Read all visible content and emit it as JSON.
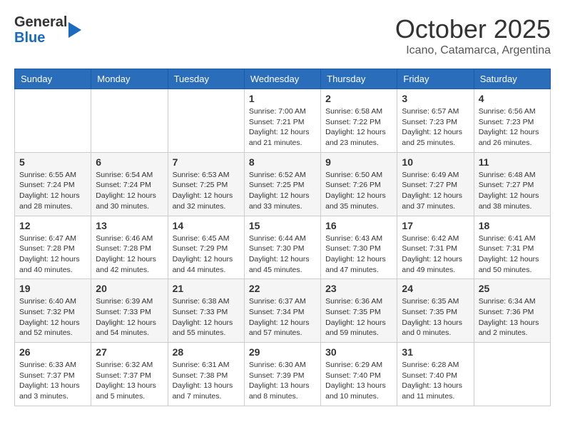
{
  "header": {
    "logo_general": "General",
    "logo_blue": "Blue",
    "month": "October 2025",
    "location": "Icano, Catamarca, Argentina"
  },
  "days_of_week": [
    "Sunday",
    "Monday",
    "Tuesday",
    "Wednesday",
    "Thursday",
    "Friday",
    "Saturday"
  ],
  "weeks": [
    [
      {
        "day": "",
        "info": ""
      },
      {
        "day": "",
        "info": ""
      },
      {
        "day": "",
        "info": ""
      },
      {
        "day": "1",
        "info": "Sunrise: 7:00 AM\nSunset: 7:21 PM\nDaylight: 12 hours\nand 21 minutes."
      },
      {
        "day": "2",
        "info": "Sunrise: 6:58 AM\nSunset: 7:22 PM\nDaylight: 12 hours\nand 23 minutes."
      },
      {
        "day": "3",
        "info": "Sunrise: 6:57 AM\nSunset: 7:23 PM\nDaylight: 12 hours\nand 25 minutes."
      },
      {
        "day": "4",
        "info": "Sunrise: 6:56 AM\nSunset: 7:23 PM\nDaylight: 12 hours\nand 26 minutes."
      }
    ],
    [
      {
        "day": "5",
        "info": "Sunrise: 6:55 AM\nSunset: 7:24 PM\nDaylight: 12 hours\nand 28 minutes."
      },
      {
        "day": "6",
        "info": "Sunrise: 6:54 AM\nSunset: 7:24 PM\nDaylight: 12 hours\nand 30 minutes."
      },
      {
        "day": "7",
        "info": "Sunrise: 6:53 AM\nSunset: 7:25 PM\nDaylight: 12 hours\nand 32 minutes."
      },
      {
        "day": "8",
        "info": "Sunrise: 6:52 AM\nSunset: 7:25 PM\nDaylight: 12 hours\nand 33 minutes."
      },
      {
        "day": "9",
        "info": "Sunrise: 6:50 AM\nSunset: 7:26 PM\nDaylight: 12 hours\nand 35 minutes."
      },
      {
        "day": "10",
        "info": "Sunrise: 6:49 AM\nSunset: 7:27 PM\nDaylight: 12 hours\nand 37 minutes."
      },
      {
        "day": "11",
        "info": "Sunrise: 6:48 AM\nSunset: 7:27 PM\nDaylight: 12 hours\nand 38 minutes."
      }
    ],
    [
      {
        "day": "12",
        "info": "Sunrise: 6:47 AM\nSunset: 7:28 PM\nDaylight: 12 hours\nand 40 minutes."
      },
      {
        "day": "13",
        "info": "Sunrise: 6:46 AM\nSunset: 7:28 PM\nDaylight: 12 hours\nand 42 minutes."
      },
      {
        "day": "14",
        "info": "Sunrise: 6:45 AM\nSunset: 7:29 PM\nDaylight: 12 hours\nand 44 minutes."
      },
      {
        "day": "15",
        "info": "Sunrise: 6:44 AM\nSunset: 7:30 PM\nDaylight: 12 hours\nand 45 minutes."
      },
      {
        "day": "16",
        "info": "Sunrise: 6:43 AM\nSunset: 7:30 PM\nDaylight: 12 hours\nand 47 minutes."
      },
      {
        "day": "17",
        "info": "Sunrise: 6:42 AM\nSunset: 7:31 PM\nDaylight: 12 hours\nand 49 minutes."
      },
      {
        "day": "18",
        "info": "Sunrise: 6:41 AM\nSunset: 7:31 PM\nDaylight: 12 hours\nand 50 minutes."
      }
    ],
    [
      {
        "day": "19",
        "info": "Sunrise: 6:40 AM\nSunset: 7:32 PM\nDaylight: 12 hours\nand 52 minutes."
      },
      {
        "day": "20",
        "info": "Sunrise: 6:39 AM\nSunset: 7:33 PM\nDaylight: 12 hours\nand 54 minutes."
      },
      {
        "day": "21",
        "info": "Sunrise: 6:38 AM\nSunset: 7:33 PM\nDaylight: 12 hours\nand 55 minutes."
      },
      {
        "day": "22",
        "info": "Sunrise: 6:37 AM\nSunset: 7:34 PM\nDaylight: 12 hours\nand 57 minutes."
      },
      {
        "day": "23",
        "info": "Sunrise: 6:36 AM\nSunset: 7:35 PM\nDaylight: 12 hours\nand 59 minutes."
      },
      {
        "day": "24",
        "info": "Sunrise: 6:35 AM\nSunset: 7:35 PM\nDaylight: 13 hours\nand 0 minutes."
      },
      {
        "day": "25",
        "info": "Sunrise: 6:34 AM\nSunset: 7:36 PM\nDaylight: 13 hours\nand 2 minutes."
      }
    ],
    [
      {
        "day": "26",
        "info": "Sunrise: 6:33 AM\nSunset: 7:37 PM\nDaylight: 13 hours\nand 3 minutes."
      },
      {
        "day": "27",
        "info": "Sunrise: 6:32 AM\nSunset: 7:37 PM\nDaylight: 13 hours\nand 5 minutes."
      },
      {
        "day": "28",
        "info": "Sunrise: 6:31 AM\nSunset: 7:38 PM\nDaylight: 13 hours\nand 7 minutes."
      },
      {
        "day": "29",
        "info": "Sunrise: 6:30 AM\nSunset: 7:39 PM\nDaylight: 13 hours\nand 8 minutes."
      },
      {
        "day": "30",
        "info": "Sunrise: 6:29 AM\nSunset: 7:40 PM\nDaylight: 13 hours\nand 10 minutes."
      },
      {
        "day": "31",
        "info": "Sunrise: 6:28 AM\nSunset: 7:40 PM\nDaylight: 13 hours\nand 11 minutes."
      },
      {
        "day": "",
        "info": ""
      }
    ]
  ]
}
